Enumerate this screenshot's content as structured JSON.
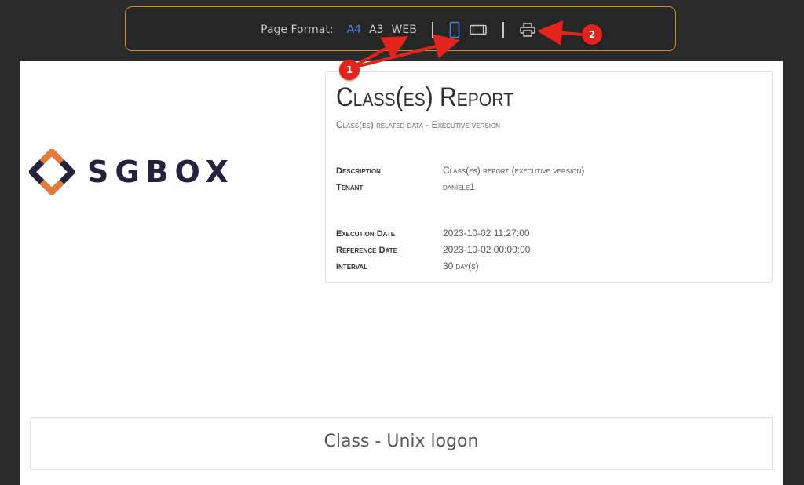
{
  "toolbar": {
    "label": "Page Format:",
    "formats": [
      "A4",
      "A3",
      "WEB"
    ],
    "active_format": "A4",
    "icons": [
      "portrait-icon",
      "landscape-icon",
      "print-icon"
    ],
    "accent": "#4d7fe0",
    "border_color": "#d98a1f"
  },
  "logo": {
    "text": "SGBOX",
    "colors": [
      "#e07b39",
      "#25223d"
    ]
  },
  "report": {
    "title": "Class(es) Report",
    "subtitle": "Class(es) related data - Executive version",
    "fields": [
      {
        "label": "Description",
        "value": "Class(es) report (executive version)"
      },
      {
        "label": "Tenant",
        "value": "daniele1"
      },
      {
        "label": "Execution Date",
        "value": "2023-10-02 11:27:00"
      },
      {
        "label": "Reference Date",
        "value": "2023-10-02 00:00:00"
      },
      {
        "label": "Interval",
        "value": "30",
        "unit": "day(s)"
      }
    ]
  },
  "section": {
    "title": "Class - Unix logon"
  },
  "annotations": {
    "badges": [
      "1",
      "2"
    ],
    "color": "#e3241c"
  }
}
